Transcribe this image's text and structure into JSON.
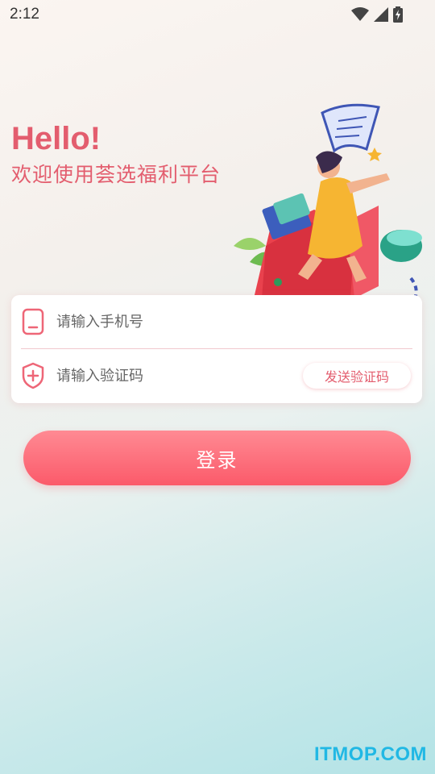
{
  "status_bar": {
    "time": "2:12",
    "icons": [
      "wifi-icon",
      "signal-icon",
      "battery-icon"
    ]
  },
  "header": {
    "greeting": "Hello!",
    "welcome": "欢迎使用荟选福利平台"
  },
  "login_form": {
    "phone_placeholder": "请输入手机号",
    "phone_value": "",
    "code_placeholder": "请输入验证码",
    "code_value": "",
    "send_code_label": "发送验证码"
  },
  "login_button_label": "登录",
  "watermark": "ITMOP.COM",
  "colors": {
    "accent": "#e35d6e",
    "button_top": "#ff8a93",
    "button_bottom": "#fb5a6a",
    "watermark": "#21b8e4"
  }
}
